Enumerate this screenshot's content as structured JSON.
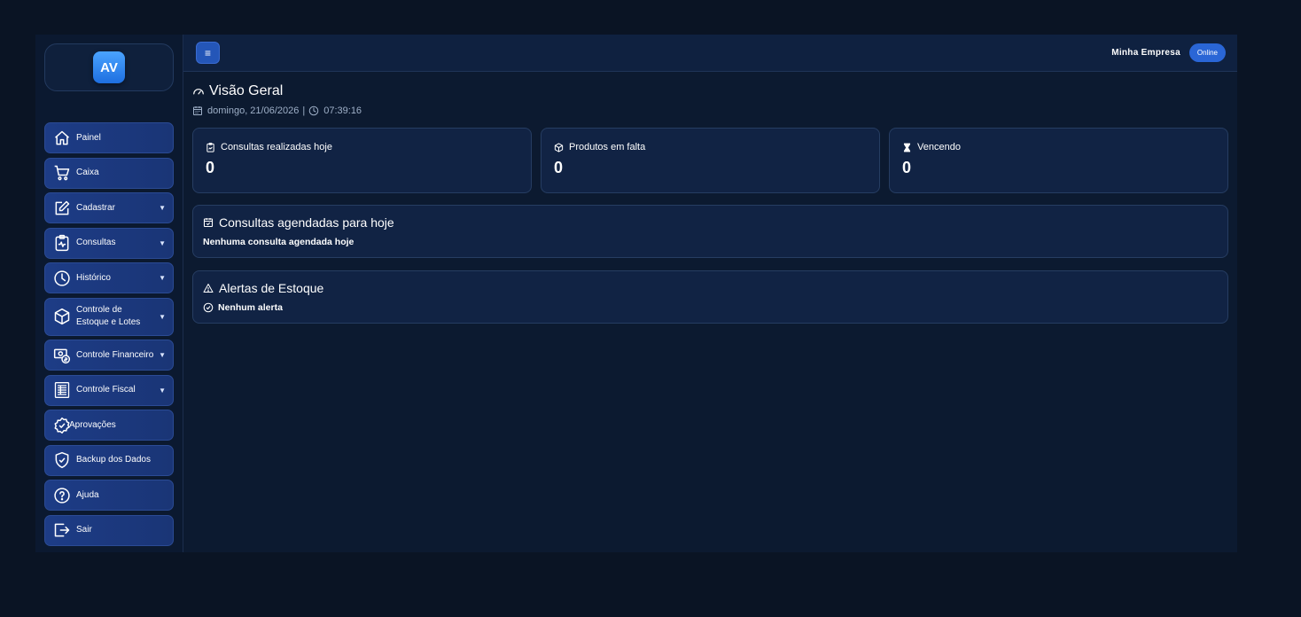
{
  "logo": {
    "text": "AV"
  },
  "sidebar": {
    "items": [
      {
        "label": "Painel",
        "icon": "home-icon",
        "caret": ""
      },
      {
        "label": "Caixa",
        "icon": "cart-icon",
        "caret": ""
      },
      {
        "label": "Cadastrar",
        "icon": "edit-icon",
        "caret": "▼"
      },
      {
        "label": "Consultas",
        "icon": "clipboard-pulse-icon",
        "caret": "▼"
      },
      {
        "label": "Histórico",
        "icon": "clock-icon",
        "caret": "▼"
      },
      {
        "label": "Controle de Estoque e Lotes",
        "icon": "box-icon",
        "caret": "▼"
      },
      {
        "label": "Controle Financeiro",
        "icon": "cash-icon",
        "caret": "▼"
      },
      {
        "label": "Controle Fiscal",
        "icon": "receipt-icon",
        "caret": "▼"
      },
      {
        "label": "Aprovações",
        "icon": "badge-check-icon",
        "caret": ""
      },
      {
        "label": "Backup dos Dados",
        "icon": "shield-check-icon",
        "caret": ""
      },
      {
        "label": "Ajuda",
        "icon": "help-icon",
        "caret": ""
      },
      {
        "label": "Sair",
        "icon": "logout-icon",
        "caret": ""
      }
    ]
  },
  "topbar": {
    "menu_icon": "≡",
    "company": "Minha Empresa",
    "status": "Online"
  },
  "page": {
    "title": "Visão Geral",
    "date": "domingo, 21/06/2026",
    "separator": "|",
    "time": "07:39:16"
  },
  "stats": [
    {
      "label": "Consultas realizadas hoje",
      "value": "0",
      "icon": "clipboard-icon"
    },
    {
      "label": "Produtos em falta",
      "value": "0",
      "icon": "box-icon"
    },
    {
      "label": "Vencendo",
      "value": "0",
      "icon": "hourglass-icon"
    }
  ],
  "scheduled": {
    "title": "Consultas agendadas para hoje",
    "text": "Nenhuma consulta agendada hoje"
  },
  "alerts": {
    "title": "Alertas de Estoque",
    "text": "Nenhum alerta"
  },
  "colors": {
    "background": "#0a1424",
    "sidebar_button": "#1d3c86",
    "accent": "#2a66d6",
    "card": "#112344"
  }
}
